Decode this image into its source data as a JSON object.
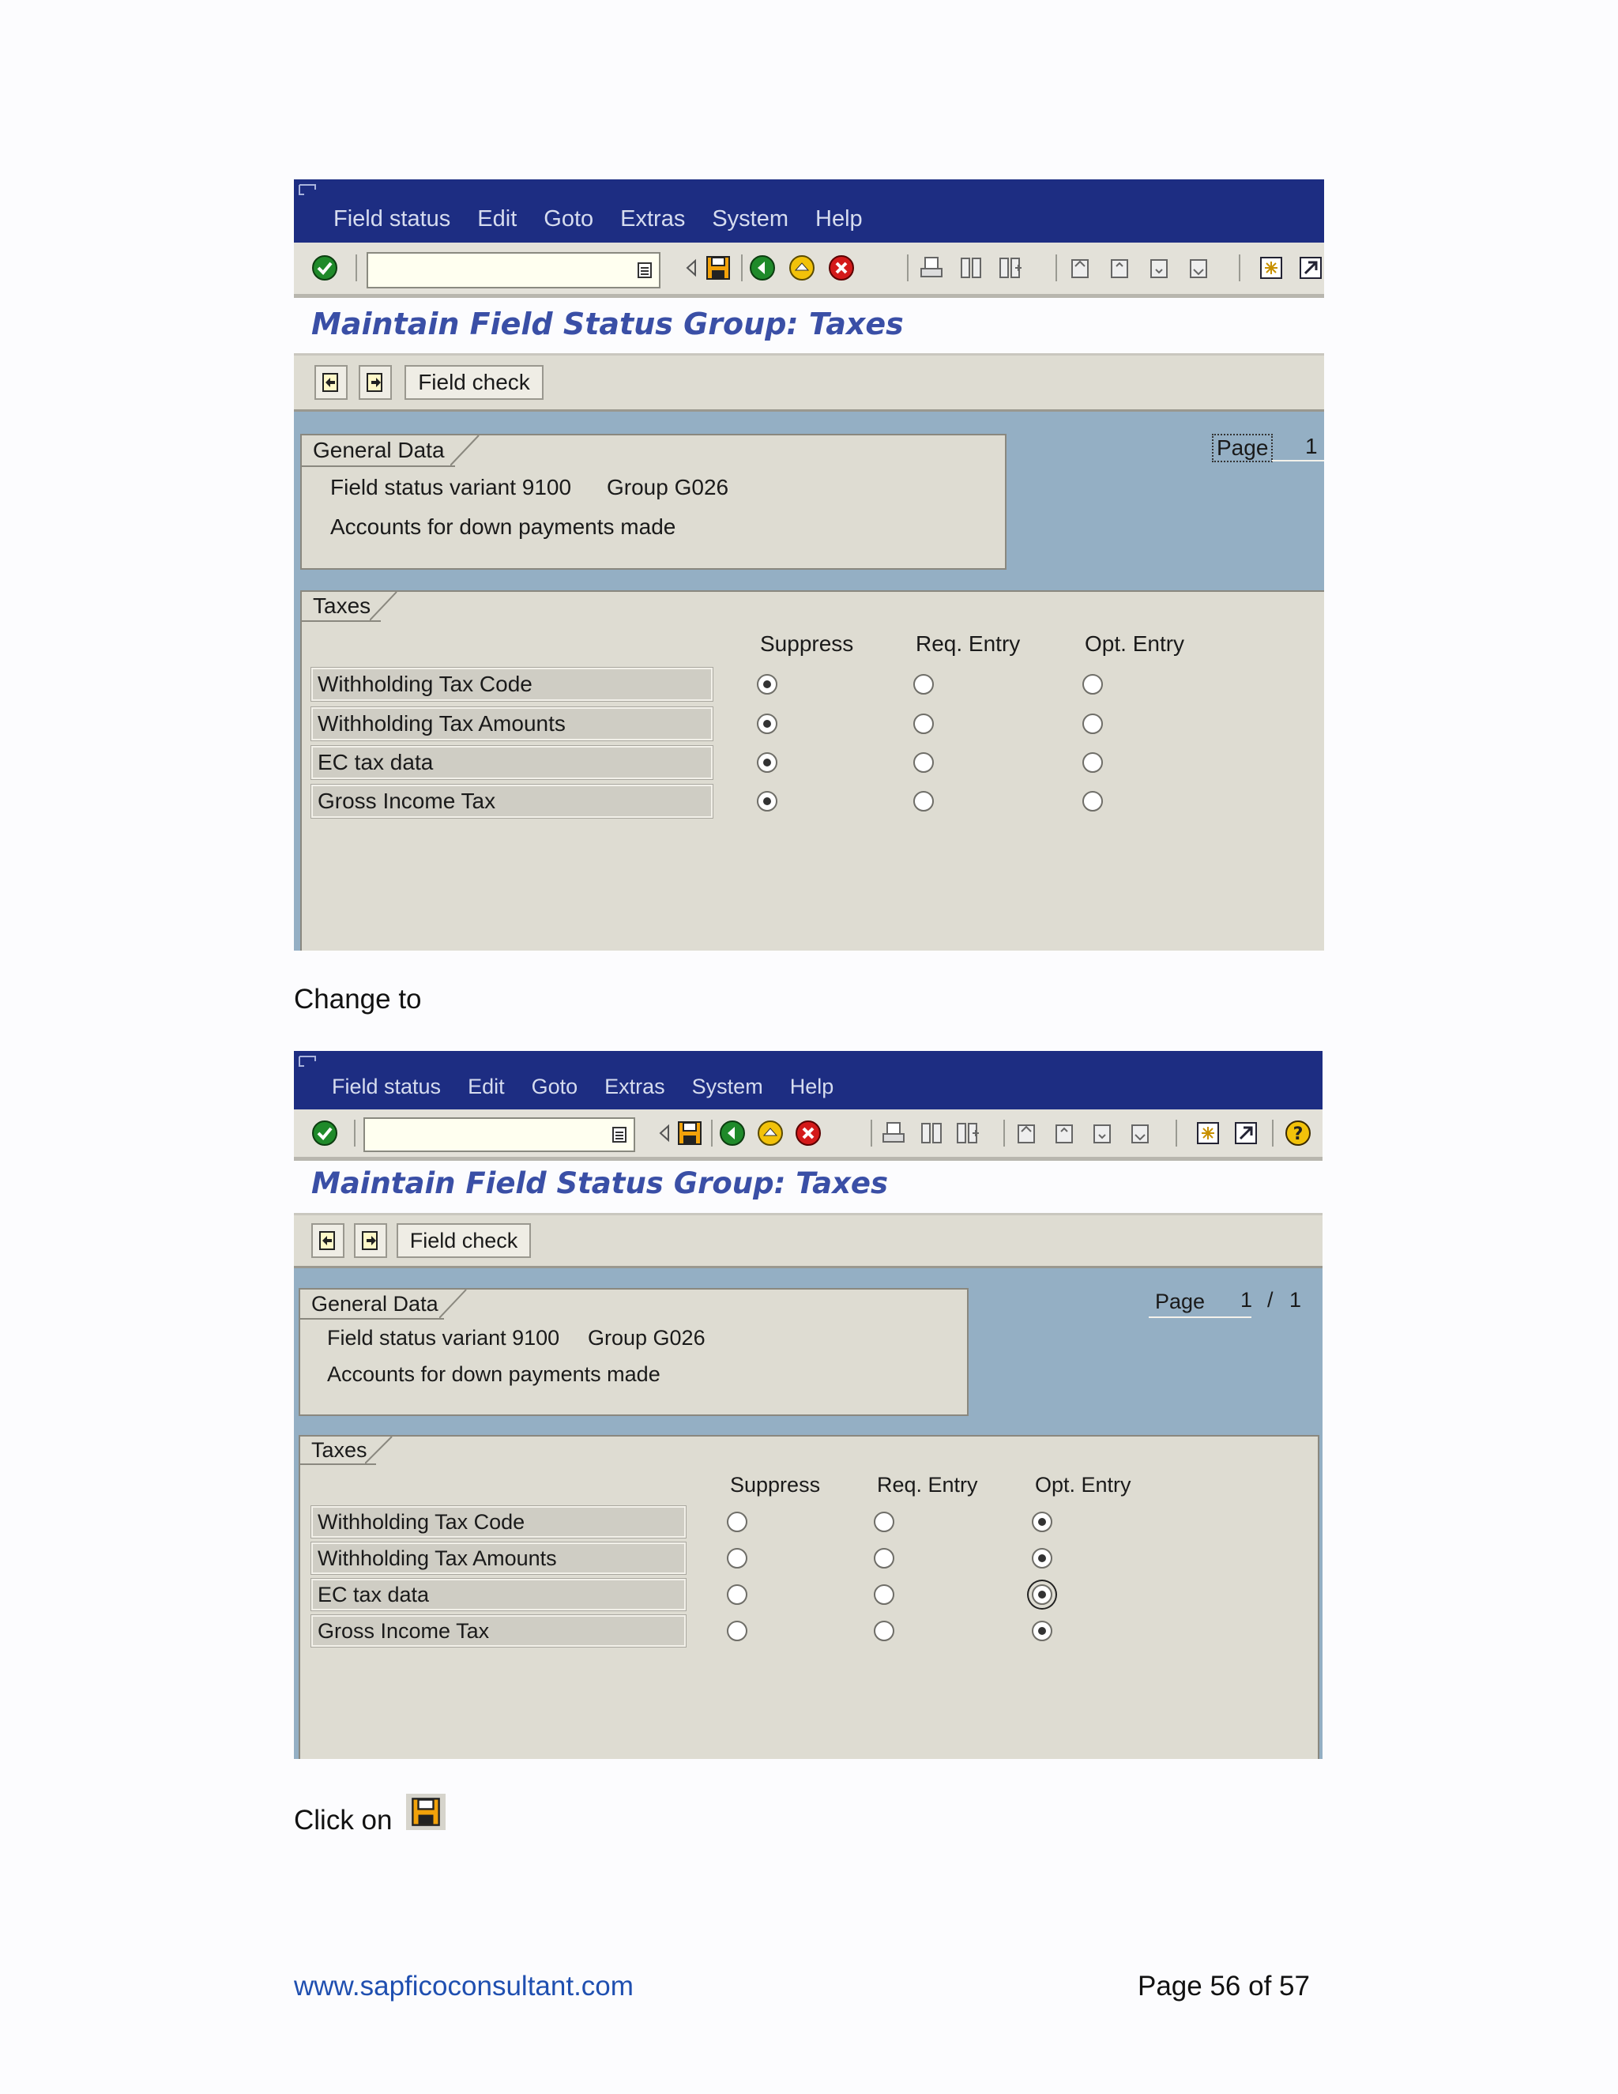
{
  "screens": [
    {
      "menu": [
        "Field status",
        "Edit",
        "Goto",
        "Extras",
        "System",
        "Help"
      ],
      "title": "Maintain Field Status Group: Taxes",
      "field_check": "Field check",
      "page_label": "Page",
      "page_value": "1",
      "page_total": "",
      "general_tab": "General Data",
      "variant_text": "Field status variant 9100",
      "group_text": "Group G026",
      "description": "Accounts for down payments made",
      "taxes_tab": "Taxes",
      "columns": [
        "Suppress",
        "Req. Entry",
        "Opt. Entry"
      ],
      "rows": [
        {
          "label": "Withholding Tax Code",
          "selected": "Suppress"
        },
        {
          "label": "Withholding Tax Amounts",
          "selected": "Suppress"
        },
        {
          "label": "EC tax data",
          "selected": "Suppress"
        },
        {
          "label": "Gross Income Tax",
          "selected": "Suppress"
        }
      ]
    },
    {
      "menu": [
        "Field status",
        "Edit",
        "Goto",
        "Extras",
        "System",
        "Help"
      ],
      "title": "Maintain Field Status Group: Taxes",
      "field_check": "Field check",
      "page_label": "Page",
      "page_value": "1",
      "page_sep": "/",
      "page_total": "1",
      "general_tab": "General Data",
      "variant_text": "Field status variant 9100",
      "group_text": "Group G026",
      "description": "Accounts for down payments made",
      "taxes_tab": "Taxes",
      "columns": [
        "Suppress",
        "Req. Entry",
        "Opt. Entry"
      ],
      "rows": [
        {
          "label": "Withholding Tax Code",
          "selected": "Opt. Entry"
        },
        {
          "label": "Withholding Tax Amounts",
          "selected": "Opt. Entry"
        },
        {
          "label": "EC tax data",
          "selected": "Opt. Entry"
        },
        {
          "label": "Gross Income Tax",
          "selected": "Opt. Entry"
        }
      ]
    }
  ],
  "instructions": {
    "change_to": "Change to",
    "click_on": "Click on"
  },
  "footer": {
    "website": "www.sapficoconsultant.com",
    "page": "Page 56 of 57"
  },
  "colors": {
    "menubar": "#1d2d82",
    "title": "#3a4fa6",
    "blue_area": "#94afc4",
    "panel": "#dedcd2",
    "link": "#1f4fb0"
  },
  "icons": [
    "enter-icon",
    "save-icon",
    "back-icon",
    "exit-icon",
    "cancel-icon",
    "print-icon",
    "find-icon",
    "find-next-icon",
    "first-page-icon",
    "previous-page-icon",
    "next-page-icon",
    "last-page-icon",
    "new-session-icon",
    "shortcut-icon",
    "help-icon"
  ]
}
